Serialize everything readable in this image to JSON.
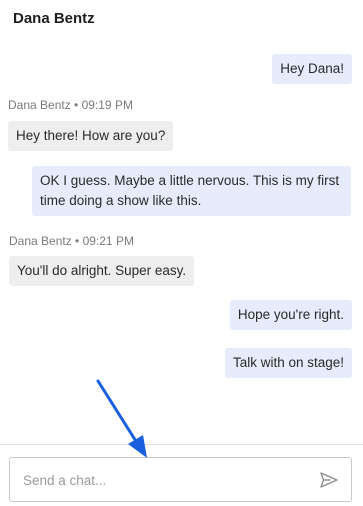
{
  "header": {
    "title": "Dana Bentz"
  },
  "messages": [
    {
      "direction": "out",
      "text": "Hey Dana!"
    },
    {
      "direction": "in",
      "sender": "Dana Bentz",
      "time": "09:19 PM",
      "text": "Hey there! How are you?"
    },
    {
      "direction": "out",
      "text_line1": "OK I guess. Maybe a little nervous. This is my first",
      "text_line2": "time doing a show like this."
    },
    {
      "direction": "in",
      "sender": "Dana Bentz",
      "time": "09:21 PM",
      "text": "You'll do alright. Super easy."
    },
    {
      "direction": "out",
      "text": "Hope you're right."
    },
    {
      "direction": "out",
      "text": "Talk with on stage!"
    }
  ],
  "meta": {
    "msg1": "Dana Bentz • 09:19 PM",
    "msg3": "Dana Bentz • 09:21 PM"
  },
  "composer": {
    "placeholder": "Send a chat...",
    "value": ""
  },
  "icons": {
    "send": "send-icon",
    "annotation": "arrow-pointer-icon"
  },
  "colors": {
    "outgoing_bubble": "#e6ecfb",
    "incoming_bubble": "#eeeeee",
    "annotation_arrow": "#1a5fe0"
  }
}
